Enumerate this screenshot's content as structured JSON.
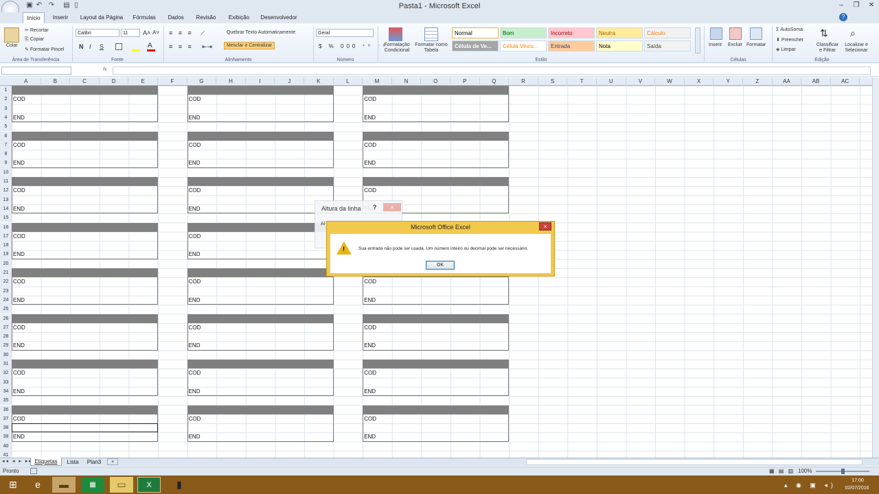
{
  "window": {
    "title": "Pasta1 - Microsoft Excel"
  },
  "ribbon_tabs": [
    "Início",
    "Inserir",
    "Layout da Página",
    "Fórmulas",
    "Dados",
    "Revisão",
    "Exibição",
    "Desenvolvedor"
  ],
  "clipboard": {
    "paste": "Colar",
    "cut": "Recortar",
    "copy": "Copiar",
    "format_painter": "Formatar Pincel",
    "group": "Área de Transferência"
  },
  "font": {
    "name": "Calibri",
    "size": "11",
    "bold": "N",
    "italic": "I",
    "underline": "S",
    "group": "Fonte"
  },
  "alignment": {
    "wrap": "Quebrar Texto Automaticamente",
    "merge": "Mesclar e Centralizar",
    "group": "Alinhamento"
  },
  "number": {
    "format": "Geral",
    "group": "Número"
  },
  "styles": {
    "cond_format": "Formatação Condicional",
    "format_table": "Formatar como Tabela",
    "items": [
      {
        "label": "Normal",
        "bg": "#ffffff",
        "fg": "#000000"
      },
      {
        "label": "Bom",
        "bg": "#c6efce",
        "fg": "#006100"
      },
      {
        "label": "Incorreto",
        "bg": "#ffc7ce",
        "fg": "#9c0006"
      },
      {
        "label": "Neutra",
        "bg": "#ffeb9c",
        "fg": "#9c6500"
      },
      {
        "label": "Cálculo",
        "bg": "#f2f2f2",
        "fg": "#fa7d00"
      },
      {
        "label": "Célula de Ve...",
        "bg": "#a5a5a5",
        "fg": "#ffffff"
      },
      {
        "label": "Célula Vincu...",
        "bg": "#ffffff",
        "fg": "#fa7d00"
      },
      {
        "label": "Entrada",
        "bg": "#ffcc99",
        "fg": "#3f3f76"
      },
      {
        "label": "Nota",
        "bg": "#ffffcc",
        "fg": "#000000"
      },
      {
        "label": "Saída",
        "bg": "#f2f2f2",
        "fg": "#3f3f3f"
      }
    ],
    "group": "Estilo"
  },
  "cells_group": {
    "insert": "Inserir",
    "delete": "Excluir",
    "format": "Formatar",
    "group": "Células"
  },
  "editing": {
    "autosum": "AutoSoma",
    "fill": "Preencher",
    "clear": "Limpar",
    "sort": "Classificar e Filtrar",
    "find": "Localizar e Selecionar",
    "group": "Edição"
  },
  "formula_bar": {
    "fx": "fx",
    "value": ""
  },
  "columns": [
    "A",
    "B",
    "C",
    "D",
    "E",
    "F",
    "G",
    "H",
    "I",
    "J",
    "K",
    "L",
    "M",
    "N",
    "O",
    "P",
    "Q",
    "R",
    "S",
    "T",
    "U",
    "V",
    "W",
    "X",
    "Y",
    "Z",
    "AA",
    "AB",
    "AC"
  ],
  "rows": [
    "1",
    "2",
    "3",
    "4",
    "5",
    "6",
    "7",
    "8",
    "9",
    "10",
    "11",
    "12",
    "13",
    "14",
    "15",
    "16",
    "17",
    "18",
    "19",
    "20",
    "21",
    "22",
    "23",
    "24",
    "25",
    "26",
    "27",
    "28",
    "29",
    "30",
    "31",
    "32",
    "33",
    "34",
    "35",
    "36",
    "37",
    "38",
    "39",
    "40",
    "41"
  ],
  "labels": {
    "cod": "COD",
    "end": "END"
  },
  "bg_dialog": {
    "title": "Altura da linha",
    "help": "?",
    "close": "×",
    "field_label": "Al"
  },
  "alert": {
    "title": "Microsoft Office Excel",
    "close": "×",
    "message": "Sua entrada não pode ser usada. Um número inteiro ou decimal pode ser necessário.",
    "ok": "OK"
  },
  "sheets": [
    "Etiquetas",
    "Lista",
    "Plan3"
  ],
  "status": {
    "ready": "Pronto",
    "zoom": "100%"
  },
  "clock": {
    "time": "17:00",
    "date": "02/07/2016"
  }
}
